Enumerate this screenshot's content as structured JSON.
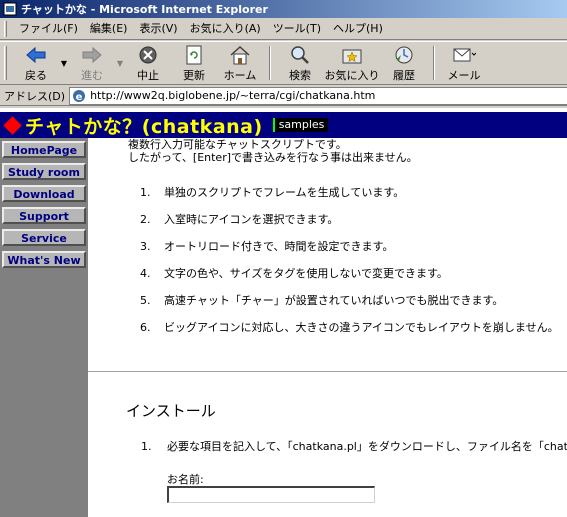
{
  "window": {
    "title": "チャットかな - Microsoft Internet Explorer"
  },
  "menu": [
    "ファイル(F)",
    "編集(E)",
    "表示(V)",
    "お気に入り(A)",
    "ツール(T)",
    "ヘルプ(H)"
  ],
  "toolbar": {
    "back": "戻る",
    "forward": "進む",
    "stop": "中止",
    "refresh": "更新",
    "home": "ホーム",
    "search": "検索",
    "favorites": "お気に入り",
    "history": "履歴",
    "mail": "メール"
  },
  "address": {
    "label": "アドレス(D)",
    "url": "http://www2q.biglobene.jp/~terra/cgi/chatkana.htm"
  },
  "page": {
    "title": "チャトかな？(chatkana)",
    "samples_tag": "samples",
    "nav": [
      "HomePage",
      "Study room",
      "Download",
      "Support",
      "Service",
      "What's New"
    ],
    "intro": [
      "複数行入力可能なチャットスクリプトです。",
      "したがって、[Enter]で書き込みを行なう事は出来ません。"
    ],
    "features": [
      {
        "num": "1.",
        "text": "単独のスクリプトでフレームを生成しています。"
      },
      {
        "num": "2.",
        "text": "入室時にアイコンを選択できます。"
      },
      {
        "num": "3.",
        "text": "オートリロード付きで、時間を設定できます。"
      },
      {
        "num": "4.",
        "text": "文字の色や、サイズをタグを使用しないで変更できます。"
      },
      {
        "num": "5.",
        "text": "高速チャット「チャー」が設置されていればいつでも脱出できます。"
      },
      {
        "num": "6.",
        "text": "ビッグアイコンに対応し、大きさの違うアイコンでもレイアウトを崩しません。"
      }
    ],
    "install_title": "インストール",
    "step1": {
      "num": "1.",
      "text": "必要な項目を記入して、「chatkana.pl」をダウンロードし、ファイル名を「chatka"
    },
    "name_label": "お名前:",
    "name_value": ""
  },
  "colors": {
    "banner_bg": "#000080",
    "title_text": "#ffff00",
    "nav_text": "#000080",
    "diamond": "#ff0000"
  }
}
